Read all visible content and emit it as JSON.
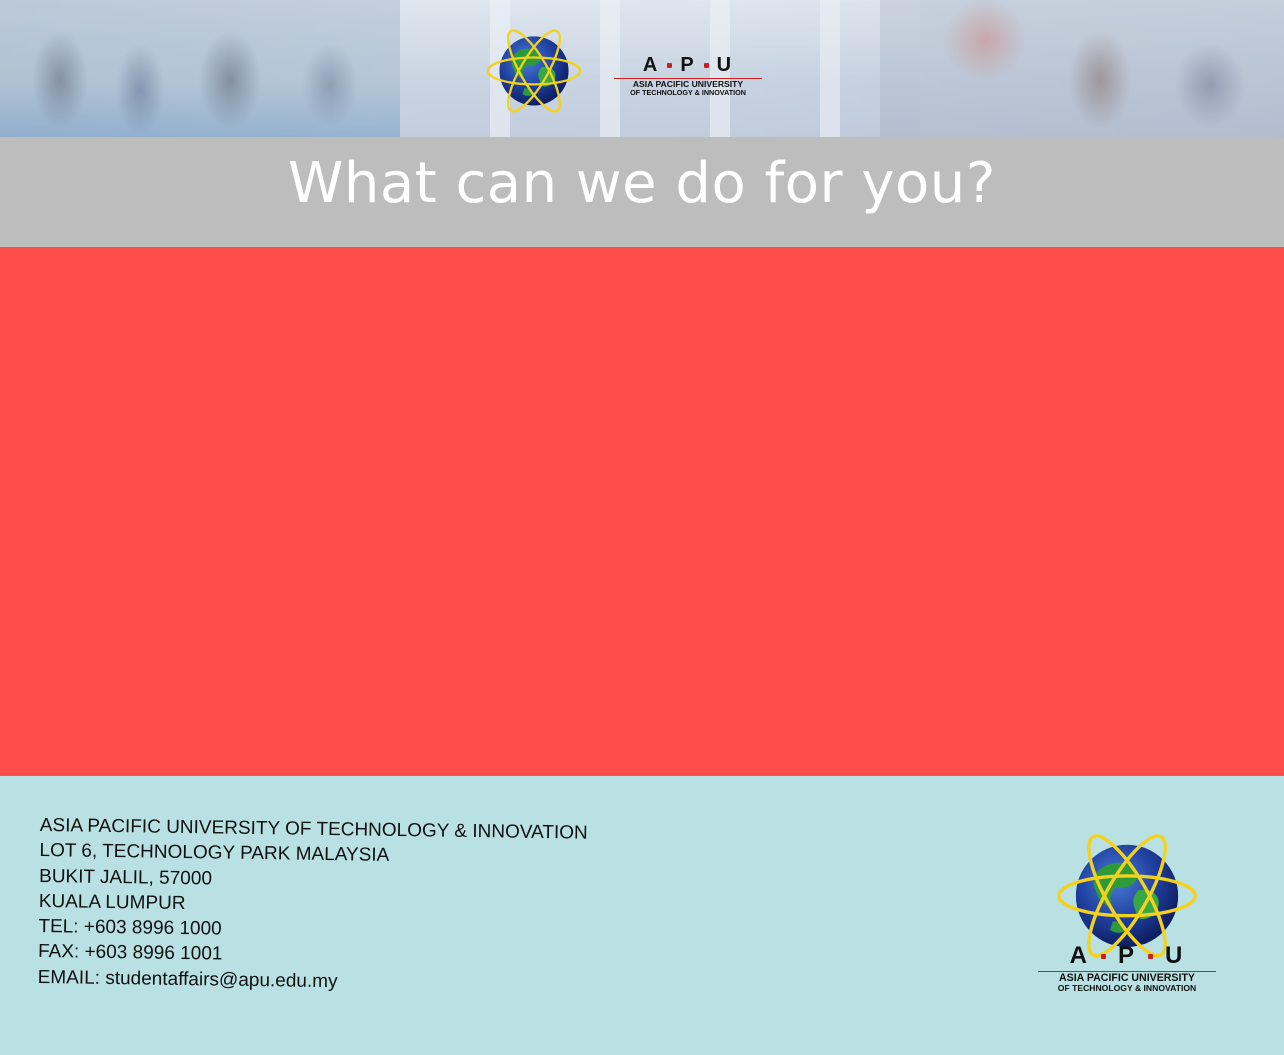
{
  "header": {
    "brand_letters": [
      "A",
      "P",
      "U"
    ],
    "brand_line1": "ASIA PACIFIC UNIVERSITY",
    "brand_line2": "OF TECHNOLOGY & INNOVATION"
  },
  "title": "What can we do for you?",
  "footer": {
    "address_lines": [
      "ASIA PACIFIC UNIVERSITY OF TECHNOLOGY & INNOVATION",
      "LOT 6, TECHNOLOGY PARK MALAYSIA",
      "BUKIT JALIL, 57000",
      "KUALA LUMPUR",
      "TEL: +603 8996 1000",
      "FAX: +603 8996 1001",
      "EMAIL: studentaffairs@apu.edu.my"
    ],
    "brand_letters": [
      "A",
      "P",
      "U"
    ],
    "brand_line1": "ASIA PACIFIC UNIVERSITY",
    "brand_line2": "OF TECHNOLOGY & INNOVATION"
  },
  "colors": {
    "title_bar": "#bdbdbd",
    "content_area": "#ff4d4c",
    "footer": "#b9e1e3",
    "brand_red": "#cc1f1f"
  },
  "icons": [
    "globe-atom-logo-icon"
  ]
}
